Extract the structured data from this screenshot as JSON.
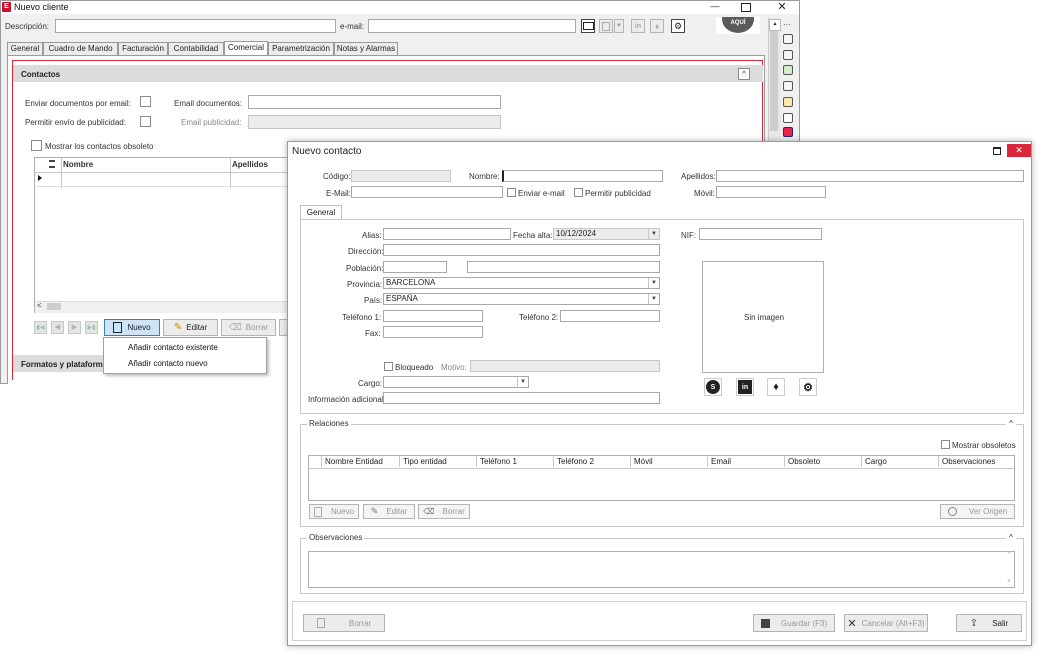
{
  "main_window": {
    "title": "Nuevo cliente",
    "app_badge": "E",
    "descripcion_label": "Descripción:",
    "email_label": "e-mail:",
    "aqui_logo": "AQUÍ",
    "tabs": [
      {
        "label": "General"
      },
      {
        "label": "Cuadro de Mando"
      },
      {
        "label": "Facturación"
      },
      {
        "label": "Contabilidad"
      },
      {
        "label": "Comercial"
      },
      {
        "label": "Parametrización"
      },
      {
        "label": "Notas y Alarmas"
      }
    ],
    "contactos": {
      "title": "Contactos",
      "enviar_docs_label": "Enviar documentos por email:",
      "email_docs_label": "Email documentos:",
      "permitir_publicidad_label": "Permitir envío de publicidad:",
      "email_publicidad_label": "Email publicidad:",
      "mostrar_obsoletos_label": "Mostrar los contactos obsoleto",
      "grid_columns": [
        "Nombre",
        "Apellidos"
      ]
    },
    "toolbar": {
      "nuevo": "Nuevo",
      "editar": "Editar",
      "borrar": "Borrar"
    },
    "dropdown_items": [
      "Añadir contacto existente",
      "Añadir contacto nuevo"
    ],
    "formatos_label": "Formatos y plataform"
  },
  "dialog": {
    "title": "Nuevo contacto",
    "codigo_label": "Código:",
    "nombre_label": "Nombre:",
    "apellidos_label": "Apellidos:",
    "email_label": "E-Mail:",
    "enviar_email_label": "Enviar e-mail",
    "permitir_publicidad_label": "Permitir publicidad",
    "movil_label": "Móvil:",
    "tab_general": "General",
    "alias_label": "Alias:",
    "fecha_alta_label": "Fecha alta:",
    "fecha_alta_value": "10/12/2024",
    "nif_label": "NIF:",
    "direccion_label": "Dirección:",
    "poblacion_label": "Población:",
    "provincia_label": "Provincia:",
    "provincia_value": "BARCELONA",
    "pais_label": "País:",
    "pais_value": "ESPAÑA",
    "telefono1_label": "Teléfono 1:",
    "telefono2_label": "Teléfono 2:",
    "fax_label": "Fax:",
    "sin_imagen": "Sin imagen",
    "bloqueado_label": "Bloqueado",
    "motivo_label": "Motivo:",
    "cargo_label": "Cargo:",
    "info_adicional_label": "Información adicional:",
    "relaciones": {
      "title": "Relaciones",
      "mostrar_obsoletos": "Mostrar obsoletos",
      "columns": [
        "Nombre Entidad",
        "Tipo entidad",
        "Teléfono 1",
        "Teléfono 2",
        "Móvil",
        "Email",
        "Obsoleto",
        "Cargo",
        "Observaciones"
      ],
      "nuevo": "Nuevo",
      "editar": "Editar",
      "borrar": "Borrar",
      "ver_origen": "Ver Origen"
    },
    "observaciones_title": "Observaciones",
    "footer": {
      "borrar": "Borrar",
      "guardar": "Guardar (F3)",
      "cancelar": "Cancelar (Alt+F3)",
      "salir": "Salir"
    }
  },
  "colors": {
    "accent_red": "#d9283b",
    "selection_blue": "#cde4f7",
    "section_header": "#dcdcdc"
  }
}
